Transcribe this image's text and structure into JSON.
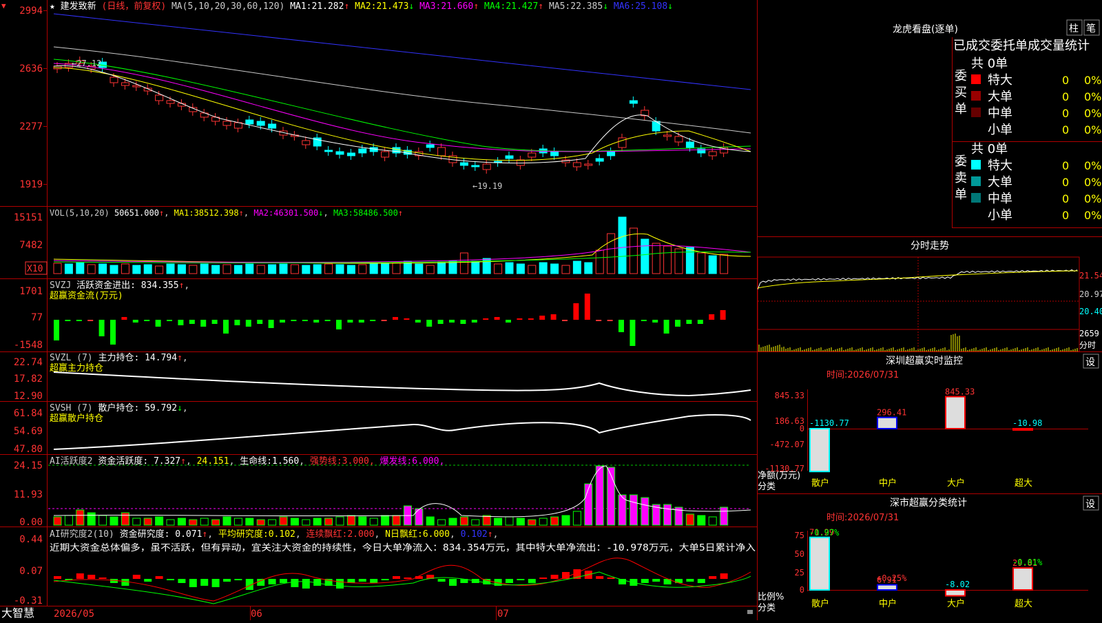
{
  "app": {
    "name": "大智慧",
    "date_start": "2026/05",
    "month_06": "06",
    "month_07": "07"
  },
  "main": {
    "title": "建发致新",
    "period": "(日线，前复权)",
    "ma_params": "MA(5,10,20,30,60,120)",
    "ma": [
      {
        "label": "MA1:",
        "value": "21.282",
        "arrow": "↑",
        "color": "#ffffff"
      },
      {
        "label": "MA2:",
        "value": "21.473",
        "arrow": "↓",
        "color": "#ffff00"
      },
      {
        "label": "MA3:",
        "value": "21.660",
        "arrow": "↑",
        "color": "#ff00ff"
      },
      {
        "label": "MA4:",
        "value": "21.427",
        "arrow": "↑",
        "color": "#00ff00"
      },
      {
        "label": "MA5:",
        "value": "22.385",
        "arrow": "↓",
        "color": "#cccccc"
      },
      {
        "label": "MA6:",
        "value": "25.108",
        "arrow": "↓",
        "color": "#3333ff"
      }
    ],
    "y_ticks": [
      "2994",
      "2636",
      "2277",
      "1919"
    ],
    "high_marker": "←27.12",
    "low_marker": "←19.19"
  },
  "vol": {
    "label": "VOL(5,10,20)",
    "value": "50651.000",
    "ma": [
      {
        "label": "MA1:",
        "value": "38512.398",
        "arrow": "↑",
        "color": "#ffff00"
      },
      {
        "label": "MA2:",
        "value": "46301.500",
        "arrow": "↓",
        "color": "#ff00ff"
      },
      {
        "label": "MA3:",
        "value": "58486.500",
        "arrow": "↑",
        "color": "#00ff00"
      }
    ],
    "y_ticks": [
      "15151",
      "7482"
    ],
    "unit": "X10"
  },
  "svzj": {
    "name": "SVZJ",
    "label": "活跃资金进出:",
    "value": "834.355",
    "arrow": "↑",
    "sub": "超赢资金流(万元)",
    "y_ticks": [
      "1701",
      "77",
      "-1548"
    ]
  },
  "svzl": {
    "name": "SVZL (7)",
    "label": "主力持仓:",
    "value": "14.794",
    "arrow": "↑",
    "sub": "超赢主力持仓",
    "y_ticks": [
      "22.74",
      "17.82",
      "12.90"
    ]
  },
  "svsh": {
    "name": "SVSH (7)",
    "label": "散户持仓:",
    "value": "59.792",
    "arrow": "↓",
    "sub": "超赢散户持仓",
    "y_ticks": [
      "61.84",
      "54.69",
      "47.80"
    ]
  },
  "ai1": {
    "name": "AI活跃度2",
    "label": "资金活跃度:",
    "value": "7.327",
    "arrow": "↑",
    "v2": "24.151",
    "life_label": "生命线:",
    "life_value": "1.560",
    "strong_label": "强势线:",
    "strong_value": "3.000",
    "burst_label": "爆发线:",
    "burst_value": "6.000",
    "y_ticks": [
      "24.15",
      "11.93",
      "0.00"
    ]
  },
  "ai2": {
    "name": "AI研究度2(10)",
    "label": "资金研究度:",
    "value": "0.071",
    "arrow": "↑",
    "avg_label": "平均研究度:",
    "avg_value": "0.102",
    "lh_label": "连续飘红:",
    "lh_value": "2.000",
    "nr_label": "N日飘红:",
    "nr_value": "6.000",
    "last_value": "0.102",
    "comment": "近期大资金总体偏多，虽不活跃，但有异动，宜关注大资金的持续性，今日大单净流入：834.354万元，其中特大单净流出：-10.978万元，大单5日累计净入",
    "y_ticks": [
      "0.44",
      "0.07",
      "-0.31"
    ]
  },
  "lhb": {
    "title": "龙虎看盘(逐单)",
    "btn_bar": "柱",
    "btn_pen": "笔",
    "subtitle": "已成交委托单成交量统计",
    "buy": {
      "side": "委买单",
      "total": "共 0单",
      "rows": [
        {
          "name": "特大",
          "count": "0",
          "pct": "0%",
          "color": "#ff0000"
        },
        {
          "name": "大单",
          "count": "0",
          "pct": "0%",
          "color": "#990000"
        },
        {
          "name": "中单",
          "count": "0",
          "pct": "0%",
          "color": "#660000"
        },
        {
          "name": "小单",
          "count": "0",
          "pct": "0%",
          "color": "#000000"
        }
      ]
    },
    "sell": {
      "side": "委卖单",
      "total": "共 0单",
      "rows": [
        {
          "name": "特大",
          "count": "0",
          "pct": "0%",
          "color": "#00ffff"
        },
        {
          "name": "大单",
          "count": "0",
          "pct": "0%",
          "color": "#009999"
        },
        {
          "name": "中单",
          "count": "0",
          "pct": "0%",
          "color": "#007777"
        },
        {
          "name": "小单",
          "count": "0",
          "pct": "0%",
          "color": "#000000"
        }
      ]
    }
  },
  "intraday": {
    "title": "分时走势",
    "y_ticks": [
      "21.54",
      "20.97",
      "20.40"
    ],
    "vol_tick": "2659",
    "vol_unit": "分时"
  },
  "sz_monitor": {
    "title": "深圳超赢实时监控",
    "btn": "设",
    "time_label": "时间:",
    "time": "2026/07/31",
    "y_ticks": [
      "845.33",
      "186.63",
      "0",
      "-472.07",
      "-1130.77"
    ],
    "y_title": "净额(万元)",
    "x_title": "分类",
    "categories": [
      "散户",
      "中户",
      "大户",
      "超大"
    ],
    "values": [
      -1130.77,
      296.41,
      845.33,
      -10.98
    ],
    "labels": [
      "-1130.77",
      "296.41",
      "845.33",
      "-10.98"
    ]
  },
  "sz_class": {
    "title": "深市超赢分类统计",
    "btn": "设",
    "time_label": "时间:",
    "time": "2026/07/31",
    "y_ticks": [
      "75",
      "50",
      "25",
      "0"
    ],
    "y_title": "比例%",
    "x_title": "分类",
    "categories": [
      "散户",
      "中户",
      "大户",
      "超大"
    ],
    "values": [
      71.29,
      6.91,
      -8.02,
      29.81
    ],
    "changes": [
      "-0.97%",
      "+0.25%",
      "",
      "-0.01%"
    ],
    "labels": [
      "71.29",
      "6.91",
      "-8.02",
      "29.81"
    ]
  }
}
